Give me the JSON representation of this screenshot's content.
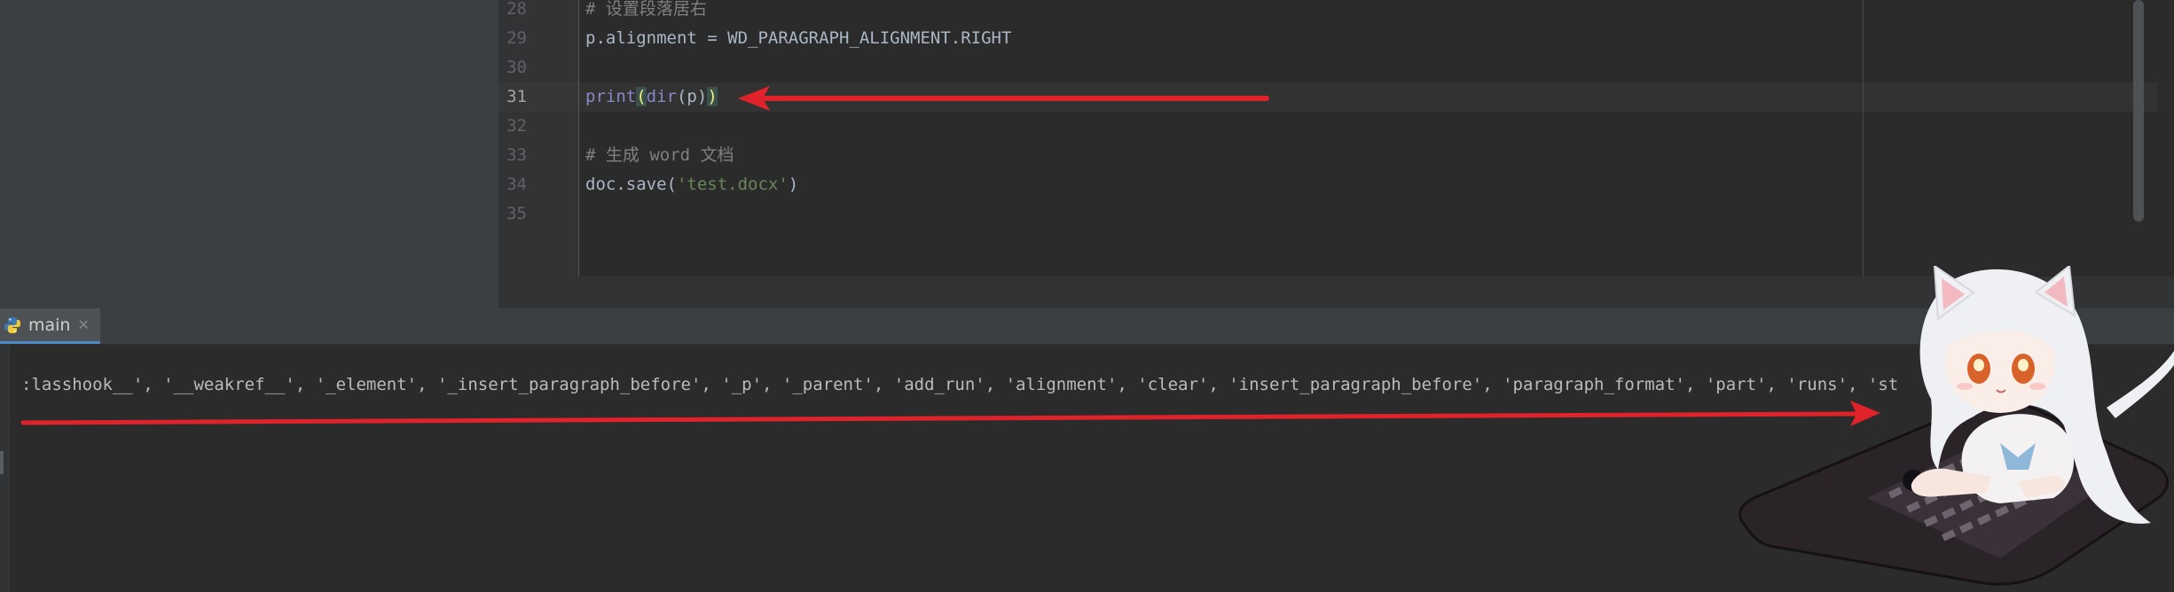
{
  "editor": {
    "lines": [
      {
        "num": "28",
        "comment": "# 设置段落居右"
      },
      {
        "num": "29",
        "code": "p.alignment = WD_PARAGRAPH_ALIGNMENT.RIGHT"
      },
      {
        "num": "30"
      },
      {
        "num": "31",
        "print": "print",
        "open": "(",
        "dir": "dir",
        "args": "(p)",
        "close": ")"
      },
      {
        "num": "32"
      },
      {
        "num": "33",
        "comment": "# 生成 word 文档"
      },
      {
        "num": "34",
        "pre": "doc.save(",
        "str": "'test.docx'",
        "post": ")"
      },
      {
        "num": "35"
      }
    ]
  },
  "run_panel": {
    "tab_label": "main",
    "output": ":lasshook__', '__weakref__', '_element', '_insert_paragraph_before', '_p', '_parent', 'add_run', 'alignment', 'clear', 'insert_paragraph_before', 'paragraph_format', 'part', 'runs', 'st"
  },
  "colors": {
    "annotation_arrow": "#e0232a",
    "editor_bg": "#2b2b2b",
    "panel_bg": "#3c3f41",
    "comment": "#808080",
    "builtin": "#8888c6",
    "string": "#6a8759"
  },
  "icons": {
    "run_tab": "python-icon",
    "close": "close-icon"
  }
}
